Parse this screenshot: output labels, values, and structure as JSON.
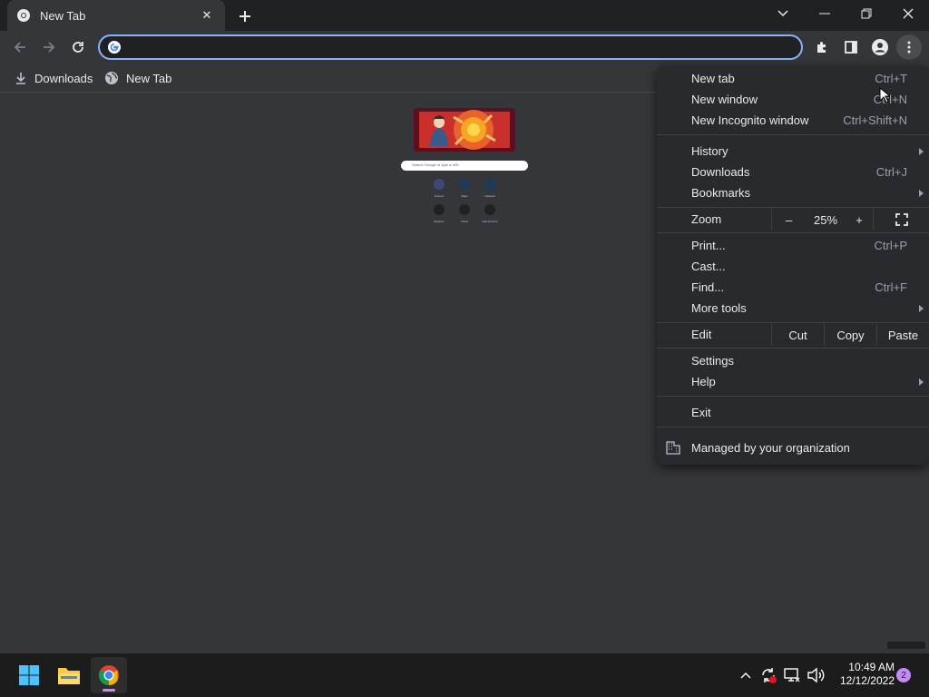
{
  "tab": {
    "title": "New Tab",
    "close": "✕"
  },
  "window": {
    "new_tab_symbol": "+"
  },
  "omnibox": {
    "value": "",
    "placeholder": ""
  },
  "bookmarks": [
    {
      "label": "Downloads",
      "icon": "download-icon"
    },
    {
      "label": "New Tab",
      "icon": "globe-icon"
    }
  ],
  "ntp": {
    "search_placeholder": "Search Google or type a URL",
    "shortcuts": [
      "Flowers",
      "Maps",
      "DataLab",
      "Weather",
      "Cloud",
      "Add shortcut"
    ]
  },
  "menu": {
    "items": [
      {
        "label": "New tab",
        "shortcut": "Ctrl+T"
      },
      {
        "label": "New window",
        "shortcut": "Ctrl+N"
      },
      {
        "label": "New Incognito window",
        "shortcut": "Ctrl+Shift+N"
      },
      {
        "label": "History",
        "submenu": true
      },
      {
        "label": "Downloads",
        "shortcut": "Ctrl+J"
      },
      {
        "label": "Bookmarks",
        "submenu": true
      },
      {
        "label": "Print...",
        "shortcut": "Ctrl+P"
      },
      {
        "label": "Cast..."
      },
      {
        "label": "Find...",
        "shortcut": "Ctrl+F"
      },
      {
        "label": "More tools",
        "submenu": true
      },
      {
        "label": "Settings"
      },
      {
        "label": "Help",
        "submenu": true
      },
      {
        "label": "Exit"
      }
    ],
    "zoom": {
      "label": "Zoom",
      "minus": "–",
      "value": "25%",
      "plus": "+"
    },
    "edit": {
      "label": "Edit",
      "cut": "Cut",
      "copy": "Copy",
      "paste": "Paste"
    },
    "managed": "Managed by your organization"
  },
  "taskbar": {
    "time": "10:49 AM",
    "date": "12/12/2022",
    "notifications": "2",
    "apps": [
      "windows-start-icon",
      "file-explorer-icon",
      "chrome-icon"
    ]
  },
  "colors": {
    "accent": "#8ab4f8",
    "menu_bg": "#292a2d",
    "page_bg": "#35363a",
    "titlebar_bg": "#202124",
    "indicator": "#c58af9"
  }
}
